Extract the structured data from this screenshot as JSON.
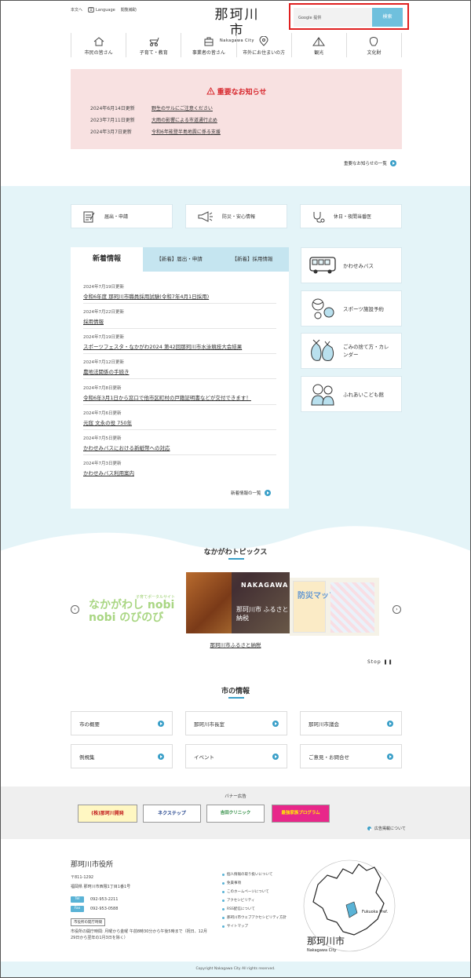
{
  "header": {
    "util_links": [
      "本文へ",
      "Language",
      "閲覧補助"
    ],
    "lang_box": "文",
    "logo_kanji": "那珂川市",
    "logo_roman": "Nakagawa City",
    "search_placeholder": "Google 提供",
    "search_button": "検索"
  },
  "gnav": [
    {
      "label": "市民の皆さん",
      "icon": "house-icon"
    },
    {
      "label": "子育て・教育",
      "icon": "stroller-icon"
    },
    {
      "label": "事業者の皆さん",
      "icon": "office-icon"
    },
    {
      "label": "市外にお住まいの方",
      "icon": "map-pin-icon"
    },
    {
      "label": "観光",
      "icon": "tent-icon"
    },
    {
      "label": "文化財",
      "icon": "artifact-icon"
    }
  ],
  "notice": {
    "title": "重要なお知らせ",
    "items": [
      {
        "date": "2024年6月14日更新",
        "title": "野生のサルにご注意ください"
      },
      {
        "date": "2023年7月11日更新",
        "title": "大雨の影響による市道通行止め"
      },
      {
        "date": "2024年3月7日更新",
        "title": "令和6年能登半島地震に係る支援"
      }
    ],
    "more": "重要なお知らせの一覧"
  },
  "quick_links": [
    {
      "label": "届出・申請",
      "icon": "form-icon"
    },
    {
      "label": "防災・安心情報",
      "icon": "megaphone-icon"
    },
    {
      "label": "休日・夜間当番医",
      "icon": "stethoscope-icon"
    }
  ],
  "news": {
    "tabs": [
      "新着情報",
      "【新着】届出・申請",
      "【新着】採用情報"
    ],
    "items": [
      {
        "date": "2024年7月19日更新",
        "title": "令和6年度 那珂川市職員採用試験(令和7年4月1日採用)"
      },
      {
        "date": "2024年7月22日更新",
        "title": "採用情報"
      },
      {
        "date": "2024年7月19日更新",
        "title": "スポーツフェスタ・なかがわ2024 第42回那珂川市水泳競技大会結果"
      },
      {
        "date": "2024年7月12日更新",
        "title": "農地法関係の手続き"
      },
      {
        "date": "2024年7月8日更新",
        "title": "令和6年3月1日から窓口で他市区町村の戸籍証明書などが交付できます！"
      },
      {
        "date": "2024年7月6日更新",
        "title": "元寇 文永の役 750年"
      },
      {
        "date": "2024年7月5日更新",
        "title": "かわせみバスにおける新紙幣への対応"
      },
      {
        "date": "2024年7月3日更新",
        "title": "かわせみバス利用案内"
      }
    ],
    "more": "新着情報の一覧"
  },
  "side_links": [
    {
      "label": "かわせみバス",
      "icon": "bus-icon"
    },
    {
      "label": "スポーツ施設予約",
      "icon": "sports-balls-icon"
    },
    {
      "label": "ごみの捨て方・カレンダー",
      "icon": "garbage-bag-icon"
    },
    {
      "label": "ふれあいこども館",
      "icon": "children-icon"
    }
  ],
  "topics": {
    "title": "なかがわトピックス",
    "left_slide_text": "なかがわし nobi nobi のびのび",
    "left_slide_sub": "子育てポータルサイト",
    "center_slide_text": "那珂川市 ふるさと納税",
    "center_slide_brand": "NAKAGAWA",
    "right_slide_text": "防災マップ",
    "caption": "那珂川市ふるさと納税",
    "stop": "Stop"
  },
  "city_info": {
    "title": "市の情報",
    "items": [
      "市の概要",
      "那珂川市長室",
      "那珂川市議会",
      "例規集",
      "イベント",
      "ご意見・お問合せ"
    ]
  },
  "banner": {
    "title": "バナー広告",
    "ads": [
      "(株)那珂川開発",
      "ネクステップ",
      "吉田クリニック",
      "最強家族プログラム"
    ],
    "about": "広告掲載について"
  },
  "footer": {
    "name": "那珂川市役所",
    "postal": "〒811-1292",
    "address": "福岡県 那珂川市西隈1丁目1番1号",
    "tel_label": "Tel",
    "tel": "092-953-2211",
    "fax_label": "Fax",
    "fax": "092-953-0588",
    "hours_tag": "市役所の開庁時間",
    "hours": "市役所の開庁時間: 月曜から金曜 午前8時30分から午後5時まで（祝日、12月29日から翌年の1月3日を除く）",
    "links": [
      "個人情報の取り扱いについて",
      "免責事項",
      "このホームページについて",
      "アクセシビリティ",
      "RSS配信について",
      "那珂川市ウェブアクセシビリティ方針",
      "サイトマップ"
    ],
    "map_label": "Fukuoka Pref.",
    "copyright": "Copyright Nakagawa City All rights reserved."
  },
  "colors": {
    "accent": "#3a9fc8",
    "notice_bg": "#f8e1e1",
    "notice_title": "#d7262c",
    "section_bg": "#e4f4f8"
  }
}
